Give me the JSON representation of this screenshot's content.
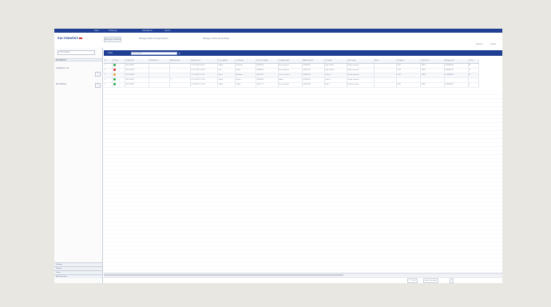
{
  "topbar": {
    "menu": [
      "Start",
      "Ticketing",
      "Operations",
      "Admin"
    ]
  },
  "brand": {
    "logo_text": "SALTOMARKS",
    "accent": "#d22e2e",
    "primary": "#1f3f92"
  },
  "header": {
    "tabs": [
      {
        "label": "Manage incidents"
      },
      {
        "label": "Manage tickets (Transportation)"
      },
      {
        "label": "Manage vehicle (Accessible)"
      }
    ],
    "right_links": [
      "Refresh",
      "Logout"
    ]
  },
  "sidebar": {
    "search_placeholder": "Find incident",
    "header": "INCIDENTS",
    "items": [
      {
        "label": "Assigned to me",
        "count": "2"
      },
      {
        "label": "All incidents",
        "count": "5"
      }
    ],
    "bottom_tabs": [
      "Settings",
      "Reports",
      "Users",
      "Administration"
    ]
  },
  "toolbar": {
    "new_label": "+ New",
    "filter_placeholder": "All incidents"
  },
  "grid": {
    "columns": [
      "ID",
      "Priority",
      "Incident ID",
      "Related inc.",
      "Related item",
      "Reported at",
      "Last update",
      "Customer",
      "Phone number",
      "Problem type",
      "Affected item",
      "Location",
      "Site name",
      "Area",
      "Progress",
      "Vehicle ID",
      "Assigned to",
      "Class"
    ],
    "rows": [
      {
        "id": "1",
        "status": "#28a745",
        "incident": "INC-00021",
        "related_inc": "",
        "related_item": "",
        "reported": "07.10.2021 09:12",
        "updated": "Today",
        "customer": "Johnson",
        "phone": "5551283",
        "problem": "No response",
        "affected": "STATION",
        "location": "Bay 2 East",
        "site": "North terminal",
        "area": "",
        "progress": "35%",
        "vehicle": "TR01",
        "assigned": "DISPATCH",
        "class": "A"
      },
      {
        "id": "2",
        "status": "#d22e2e",
        "incident": "INC-00022",
        "related_inc": "",
        "related_item": "",
        "reported": "07.10.2021 10:40",
        "updated": "Late",
        "customer": "Smith",
        "phone": "5558821",
        "problem": "No response",
        "affected": "STATION",
        "location": "Bay 4 West",
        "site": "North terminal",
        "area": "",
        "progress": "10%",
        "vehicle": "TR02",
        "assigned": "DISPATCH",
        "class": "B"
      },
      {
        "id": "3",
        "status": "#f0a030",
        "incident": "INC-00023",
        "related_inc": "",
        "related_item": "",
        "reported": "07.10.2021 11:05",
        "updated": "Soon",
        "customer": "Williams",
        "phone": "5550412",
        "problem": "Out of service",
        "affected": "STATION",
        "location": "Gate 1",
        "site": "South terminal",
        "area": "",
        "progress": "60%",
        "vehicle": "TR04",
        "assigned": "DISPATCH",
        "class": "A"
      },
      {
        "id": "4",
        "status": "#28a745",
        "incident": "INC-00024",
        "related_inc": "",
        "related_item": "1",
        "reported": "07.10.2021 12:30",
        "updated": "Today",
        "customer": "Brown",
        "phone": "5559930",
        "problem": "Alarm",
        "affected": "STATION",
        "location": "Gate 3",
        "site": "South terminal",
        "area": "",
        "progress": "",
        "vehicle": "",
        "assigned": "",
        "class": ""
      },
      {
        "id": "5",
        "status": "#28a745",
        "incident": "INC-00025",
        "related_inc": "",
        "related_item": "",
        "reported": "07.10.2021 13:48",
        "updated": "Today",
        "customer": "Taylor",
        "phone": "5557711",
        "problem": "No response",
        "affected": "STATION",
        "location": "Bay 1",
        "site": "North terminal",
        "area": "",
        "progress": "90%",
        "vehicle": "TR07",
        "assigned": "DISPATCH",
        "class": "C"
      }
    ]
  },
  "status_bar": {
    "page_info": "1 - 5 of 5",
    "page_size": "Items per page",
    "page_num": "1"
  }
}
